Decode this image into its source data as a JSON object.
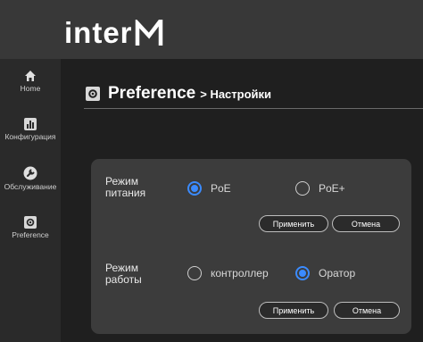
{
  "brand": {
    "logo_text": "interM"
  },
  "sidebar": {
    "items": [
      {
        "label": "Home",
        "icon": "home-icon"
      },
      {
        "label": "Конфигурация",
        "icon": "chart-icon"
      },
      {
        "label": "Обслуживание",
        "icon": "wrench-icon"
      },
      {
        "label": "Preference",
        "icon": "gear-icon"
      }
    ]
  },
  "page": {
    "title": "Preference",
    "subtitle": "> Настройки"
  },
  "power": {
    "label_line1": "Режим",
    "label_line2": "питания",
    "options": [
      {
        "label": "PoE",
        "selected": true
      },
      {
        "label": "PoE+",
        "selected": false
      }
    ],
    "apply_label": "Применить",
    "cancel_label": "Отмена"
  },
  "operation": {
    "label_line1": "Режим",
    "label_line2": "работы",
    "options": [
      {
        "label": "контроллер",
        "selected": false
      },
      {
        "label": "Оратор",
        "selected": true
      }
    ],
    "apply_label": "Применить",
    "cancel_label": "Отмена"
  },
  "colors": {
    "accent": "#3b8bff",
    "header_bg": "#383838",
    "sidebar_bg": "#2a2a2a",
    "card_bg": "#3c3c3c"
  }
}
